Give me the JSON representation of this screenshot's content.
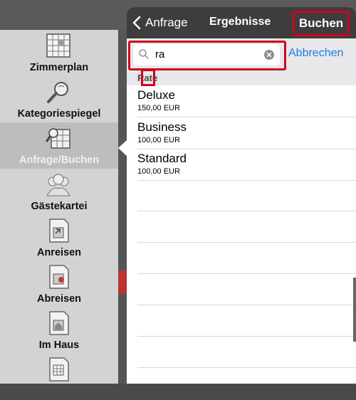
{
  "sidebar": {
    "items": [
      {
        "label": "Zimmerplan",
        "icon": "room-plan-icon"
      },
      {
        "label": "Kategoriespiegel",
        "icon": "category-mirror-icon"
      },
      {
        "label": "Anfrage/Buchen",
        "icon": "request-booking-icon",
        "active": true
      },
      {
        "label": "Gästekartei",
        "icon": "guest-list-icon"
      },
      {
        "label": "Anreisen",
        "icon": "arrivals-icon"
      },
      {
        "label": "Abreisen",
        "icon": "departures-icon"
      },
      {
        "label": "Im Haus",
        "icon": "in-house-icon"
      },
      {
        "label": "",
        "icon": "report-icon"
      }
    ]
  },
  "popover": {
    "nav": {
      "back_label": "Anfrage",
      "title": "Ergebnisse",
      "action_label": "Buchen"
    },
    "search": {
      "value": "ra",
      "placeholder": "",
      "cancel_label": "Abbrechen"
    },
    "section_header": "Rate",
    "rates": [
      {
        "name": "Deluxe",
        "price": "150,00 EUR"
      },
      {
        "name": "Business",
        "price": "100,00 EUR"
      },
      {
        "name": "Standard",
        "price": "100,00 EUR"
      }
    ]
  },
  "colors": {
    "highlight": "#d0021b",
    "link": "#1a7de6",
    "nav_bg": "#3d3d3d"
  }
}
